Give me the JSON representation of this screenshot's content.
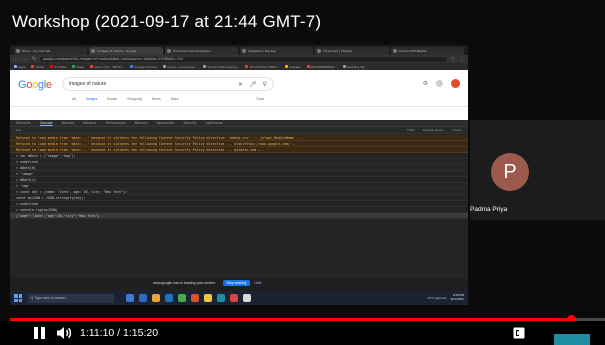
{
  "video": {
    "title": "Workshop (2021-09-17 at 21:44 GMT-7)",
    "current_time": "1:11:10",
    "duration": "1:15:20",
    "time_display": "1:11:10 / 1:15:20",
    "progress_fraction": 0.944
  },
  "browser": {
    "tabs": [
      {
        "label": "Work - my new tab"
      },
      {
        "label": "images of nature - Google"
      },
      {
        "label": "Document and Questions"
      },
      {
        "label": "Snapshot | Markup"
      },
      {
        "label": "Download | Markup"
      },
      {
        "label": "Visual GUM Master"
      }
    ],
    "active_tab_index": 1,
    "url": "google.com/search?q=images+of+nature&tbm=isch&source=hp&biw=1536&bih=754",
    "bookmarks": [
      {
        "label": "Apps",
        "color": "#8ab4f8"
      },
      {
        "label": "Gmail",
        "color": "#ea4335"
      },
      {
        "label": "YouTube",
        "color": "#ff0000"
      },
      {
        "label": "Maps",
        "color": "#34a853"
      },
      {
        "label": "Inbox (14) - SPOTI...",
        "color": "#ea4335"
      },
      {
        "label": "Google Scholar",
        "color": "#4285f4"
      },
      {
        "label": "ready - Load sensi...",
        "color": "#9aa0a6"
      },
      {
        "label": "Smart Dictionary(s)...",
        "color": "#9aa0a6"
      },
      {
        "label": "2013 ROAD WRITI...",
        "color": "#ea4335"
      },
      {
        "label": "Classes",
        "color": "#fbbc05"
      },
      {
        "label": "WAYWENSERSO...",
        "color": "#ea4335"
      },
      {
        "label": "Reading list",
        "color": "#9aa0a6"
      }
    ]
  },
  "google": {
    "logo_letters": [
      "G",
      "o",
      "o",
      "g",
      "l",
      "e"
    ],
    "query": "images of nature",
    "nav_tabs": [
      "All",
      "Images",
      "Books",
      "Shopping",
      "News",
      "More"
    ],
    "active_nav": "Images",
    "tools_label": "Tools"
  },
  "devtools": {
    "tabs": [
      "Elements",
      "Console",
      "Sources",
      "Network",
      "Performance",
      "Memory",
      "Application",
      "Security",
      "Lighthouse"
    ],
    "active_tab": "Console",
    "toolbar": {
      "context": "top",
      "filter": "Filter",
      "levels": "Default levels",
      "issues": "1 Issue"
    },
    "console_lines": [
      {
        "kind": "err",
        "text": "Refused to load media from 'data:...' because it violates the following Content Security Policy directive: 'media-src' ... jslogt_ModuleName ..."
      },
      {
        "kind": "err",
        "text": "Refused to load media from 'data:...' because it violates the following Content Security Policy directive ... blob:https://www.google.com/ ..."
      },
      {
        "kind": "err",
        "text": "Refused to load media from 'data:...' because it violates the following Content Security Policy directive ... gstatic.com ..."
      },
      {
        "kind": "log",
        "text": "> var bBoth = [\"image\",\"img\"];"
      },
      {
        "kind": "log",
        "text": "< undefined"
      },
      {
        "kind": "log",
        "text": "> bBoth[0]"
      },
      {
        "kind": "log",
        "text": "< 'image'"
      },
      {
        "kind": "log",
        "text": "> bBoth[1]"
      },
      {
        "kind": "log",
        "text": "< 'img'"
      },
      {
        "kind": "log",
        "text": "> const obj = {name: \"John\", age: 30, city: \"New York\"};"
      },
      {
        "kind": "log",
        "text": "    const myJSON = JSON.stringify(obj);"
      },
      {
        "kind": "log",
        "text": "< undefined"
      },
      {
        "kind": "log",
        "text": "> console.log(myJSON)"
      },
      {
        "kind": "sel",
        "text": "  {\"name\":\"John\",\"age\":30,\"city\":\"New York\"}"
      }
    ]
  },
  "share": {
    "message": "www.google.com is sharing your screen.",
    "stop_label": "Stop sharing",
    "hide_label": "Hide"
  },
  "taskbar": {
    "search_placeholder": "Type here to search",
    "icons": [
      "#3b7bd6",
      "#2d6cc1",
      "#e8a33a",
      "#1e73be",
      "#4aa84c",
      "#d9512c",
      "#f2c53d",
      "#1f8ea3",
      "#d94343",
      "#d9d9d9"
    ],
    "weather": "72°F Light rain",
    "clock_time": "9:44 PM",
    "clock_date": "9/17/2021"
  },
  "participant": {
    "initial": "P",
    "name": "Padma Priya",
    "avatar_color": "#9b5a4c"
  },
  "colors": {
    "progress": "#ff0000",
    "accent_teal": "#1f8ea3"
  }
}
